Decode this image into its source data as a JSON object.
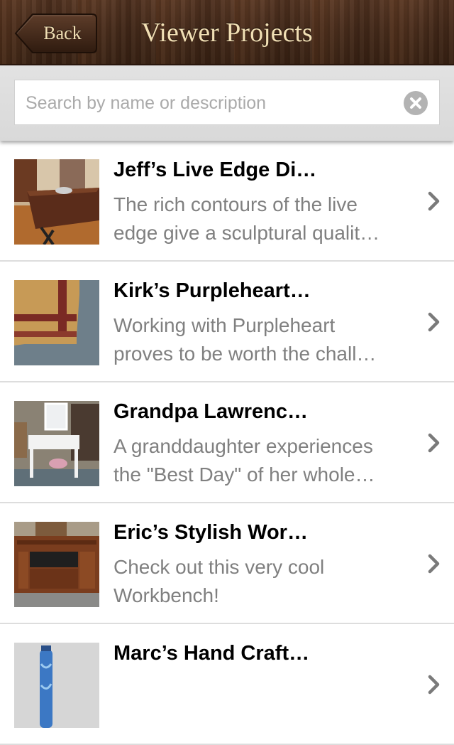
{
  "nav": {
    "back_label": "Back",
    "title": "Viewer Projects"
  },
  "search": {
    "placeholder": "Search by name or description",
    "clear_icon": "clear-circle-icon"
  },
  "items": [
    {
      "title": "Jeff’s Live Edge Di…",
      "desc_line1": "The rich contours of the live",
      "desc_line2": "edge give a sculptural qualit…"
    },
    {
      "title": "Kirk’s Purpleheart…",
      "desc_line1": "Working with Purpleheart",
      "desc_line2": "proves to be worth the chall…"
    },
    {
      "title": "Grandpa Lawrenc…",
      "desc_line1": "A granddaughter experiences",
      "desc_line2": "the \"Best Day\" of her whole…"
    },
    {
      "title": "Eric’s Stylish Wor…",
      "desc_line1": "Check out this very cool",
      "desc_line2": "Workbench!"
    },
    {
      "title": "Marc’s Hand Craft…",
      "desc_line1": "",
      "desc_line2": ""
    }
  ],
  "colors": {
    "nav_text": "#f1dfb4",
    "desc_text": "#808080",
    "separator": "#dddddd"
  }
}
